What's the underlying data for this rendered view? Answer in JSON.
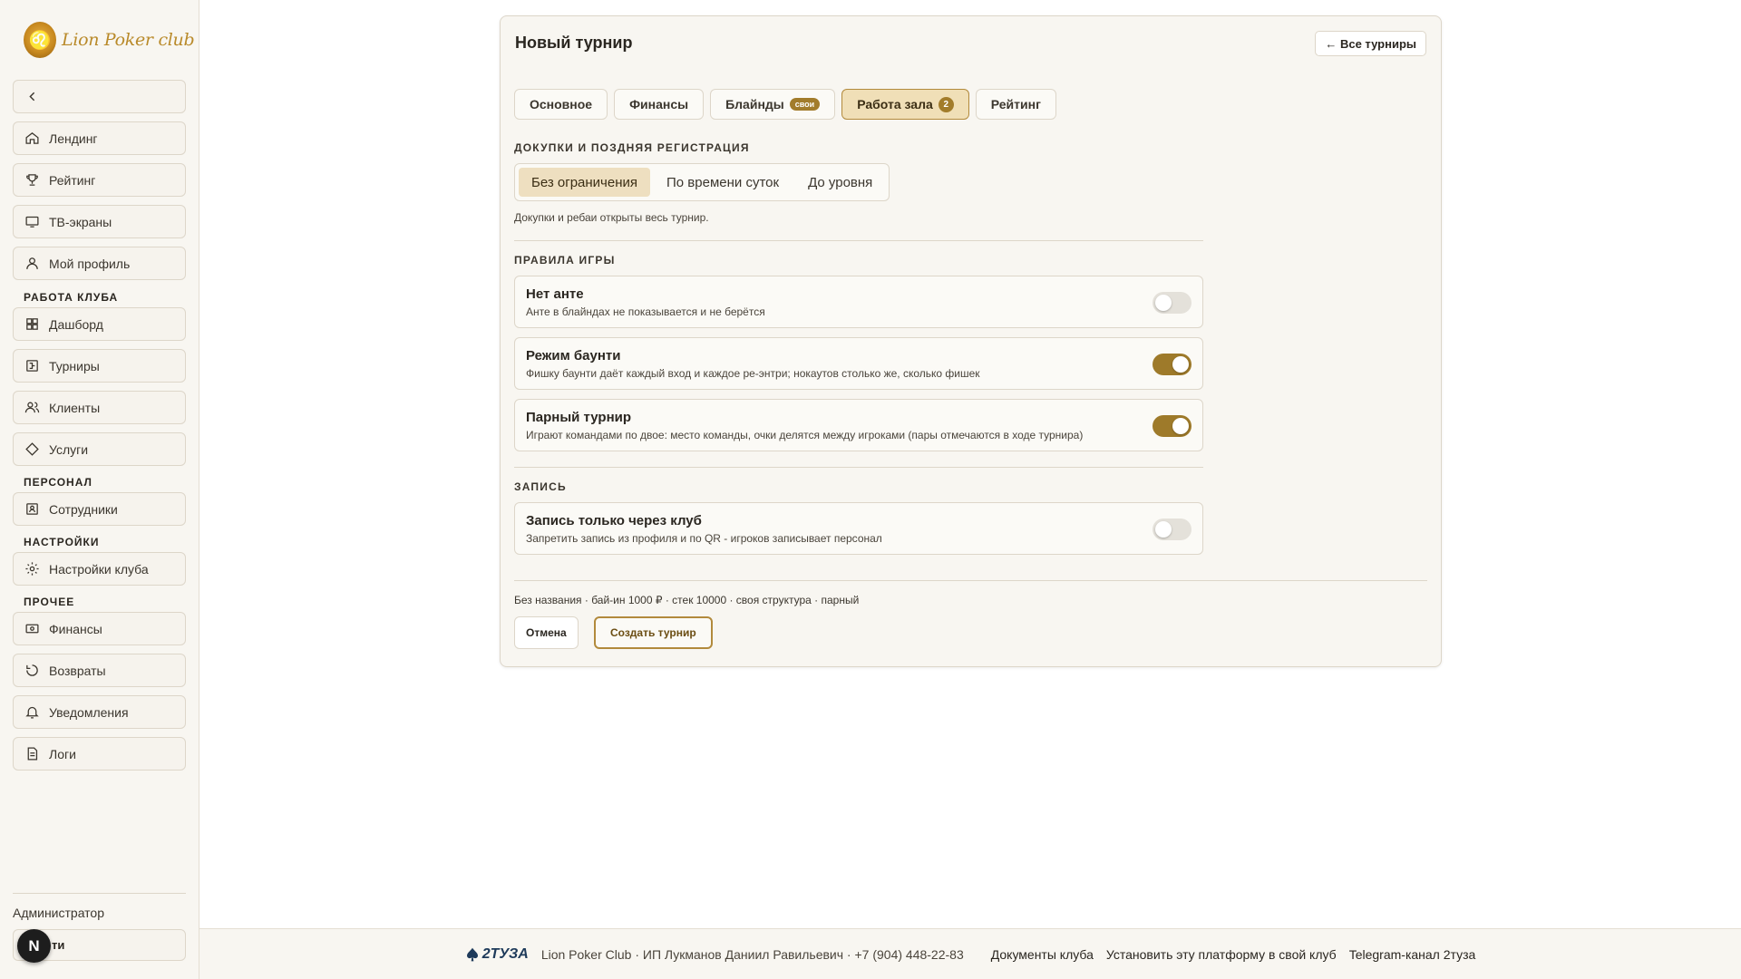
{
  "sidebar": {
    "logo_text": "Lion Poker club",
    "items": [
      {
        "label": "Лендинг"
      },
      {
        "label": "Рейтинг"
      },
      {
        "label": "ТВ-экраны"
      },
      {
        "label": "Мой профиль"
      },
      {
        "label": "Дашборд"
      },
      {
        "label": "Турниры"
      },
      {
        "label": "Клиенты"
      },
      {
        "label": "Услуги"
      },
      {
        "label": "Сотрудники"
      },
      {
        "label": "Настройки клуба"
      },
      {
        "label": "Финансы"
      },
      {
        "label": "Возвраты"
      },
      {
        "label": "Уведомления"
      },
      {
        "label": "Логи"
      }
    ],
    "sections": {
      "club_work": "РАБОТА КЛУБА",
      "staff": "ПЕРСОНАЛ",
      "settings": "НАСТРОЙКИ",
      "other": "ПРОЧЕЕ"
    },
    "role": "Администратор",
    "exit_label": "ти",
    "avatar_letter": "N"
  },
  "card": {
    "title": "Новый турнир",
    "back_label": "← Все турниры",
    "tabs": [
      {
        "label": "Основное"
      },
      {
        "label": "Финансы"
      },
      {
        "label": "Блайнды",
        "badge": "свои"
      },
      {
        "label": "Работа зала",
        "badge": "2",
        "active": true
      },
      {
        "label": "Рейтинг"
      }
    ],
    "rebuy": {
      "section": "ДОКУПКИ И ПОЗДНЯЯ РЕГИСТРАЦИЯ",
      "options": [
        "Без ограничения",
        "По времени суток",
        "До уровня"
      ],
      "selected": "Без ограничения",
      "hint": "Докупки и ребаи открыты весь турнир."
    },
    "rules": {
      "section": "ПРАВИЛА ИГРЫ",
      "items": [
        {
          "title": "Нет анте",
          "desc": "Анте в блайндах не показывается и не берётся",
          "enabled": false
        },
        {
          "title": "Режим баунти",
          "desc": "Фишку баунти даёт каждый вход и каждое ре-энтри; нокаутов столько же, сколько фишек",
          "enabled": true
        },
        {
          "title": "Парный турнир",
          "desc": "Играют командами по двое: место команды, очки делятся между игроками (пары отмечаются в ходе турнира)",
          "enabled": true
        }
      ]
    },
    "registration": {
      "section": "ЗАПИСЬ",
      "items": [
        {
          "title": "Запись только через клуб",
          "desc": "Запретить запись из профиля и по QR - игроков записывает персонал",
          "enabled": false
        }
      ]
    },
    "summary": "Без названия · бай-ин 1000 ₽ · стек 10000 · своя структура · парный",
    "cancel_label": "Отмена",
    "create_label": "Создать турнир"
  },
  "footer": {
    "brand": "2ТУЗА",
    "info": "Lion Poker Club · ИП Лукманов Даниил Равильевич · +7 (904) 448-22-83",
    "links": [
      "Документы клуба",
      "Установить эту платформу в свой клуб",
      "Telegram-канал 2туза"
    ]
  },
  "colors": {
    "accent": "#9e7a2a",
    "accent_light": "#f0dfb7",
    "background": "#f8f6f1"
  }
}
